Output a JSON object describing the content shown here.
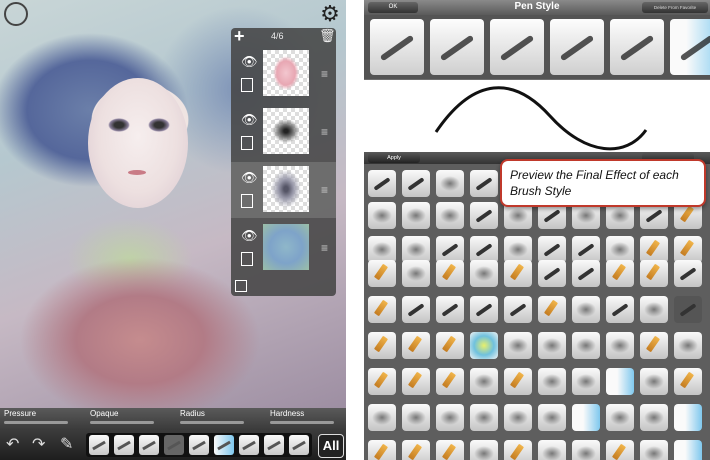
{
  "left": {
    "layers": {
      "count_label": "4/6",
      "add_icon": "plus-icon",
      "delete_icon": "trash-icon"
    },
    "sliders": [
      {
        "label": "Pressure"
      },
      {
        "label": "Opaque"
      },
      {
        "label": "Radius"
      },
      {
        "label": "Hardness"
      }
    ],
    "toolbar": {
      "all_label": "All",
      "undo_icon": "undo-icon",
      "redo_icon": "redo-icon",
      "pen_icon": "pen-icon"
    }
  },
  "right": {
    "header": {
      "ok_label": "OK",
      "title": "Pen Style",
      "delete_fav_label": "Delete From Favorite"
    },
    "apply_label": "Apply",
    "callout": "Preview the Final Effect of each Brush Style"
  },
  "colors": {
    "accent_callout_border": "#c0392b",
    "panel_dark": "#3a3a3a"
  }
}
